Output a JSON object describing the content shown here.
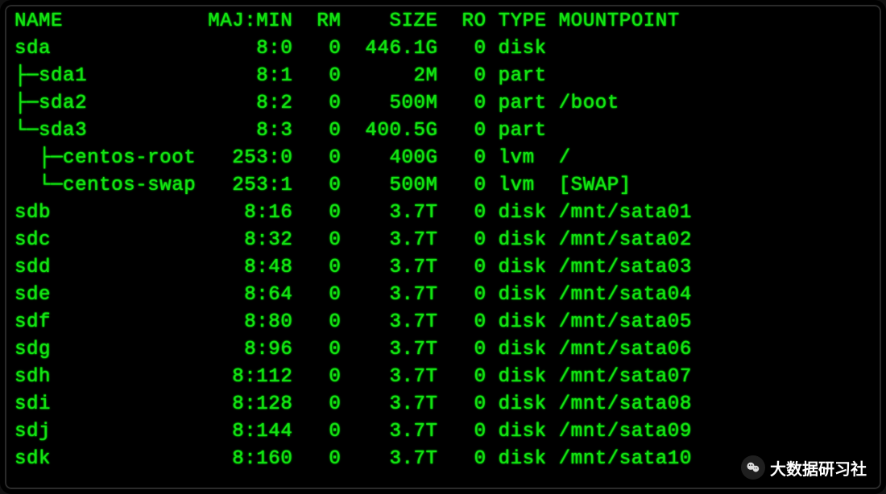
{
  "terminal": {
    "headers": {
      "name": "NAME",
      "majmin": "MAJ:MIN",
      "rm": "RM",
      "size": "SIZE",
      "ro": "RO",
      "type": "TYPE",
      "mountpoint": "MOUNTPOINT"
    },
    "rows": [
      {
        "tree": "",
        "name": "sda",
        "majmin": "8:0",
        "rm": "0",
        "size": "446.1G",
        "ro": "0",
        "type": "disk",
        "mountpoint": ""
      },
      {
        "tree": "├─",
        "name": "sda1",
        "majmin": "8:1",
        "rm": "0",
        "size": "2M",
        "ro": "0",
        "type": "part",
        "mountpoint": ""
      },
      {
        "tree": "├─",
        "name": "sda2",
        "majmin": "8:2",
        "rm": "0",
        "size": "500M",
        "ro": "0",
        "type": "part",
        "mountpoint": "/boot"
      },
      {
        "tree": "└─",
        "name": "sda3",
        "majmin": "8:3",
        "rm": "0",
        "size": "400.5G",
        "ro": "0",
        "type": "part",
        "mountpoint": ""
      },
      {
        "tree": "  ├─",
        "name": "centos-root",
        "majmin": "253:0",
        "rm": "0",
        "size": "400G",
        "ro": "0",
        "type": "lvm",
        "mountpoint": "/"
      },
      {
        "tree": "  └─",
        "name": "centos-swap",
        "majmin": "253:1",
        "rm": "0",
        "size": "500M",
        "ro": "0",
        "type": "lvm",
        "mountpoint": "[SWAP]"
      },
      {
        "tree": "",
        "name": "sdb",
        "majmin": "8:16",
        "rm": "0",
        "size": "3.7T",
        "ro": "0",
        "type": "disk",
        "mountpoint": "/mnt/sata01"
      },
      {
        "tree": "",
        "name": "sdc",
        "majmin": "8:32",
        "rm": "0",
        "size": "3.7T",
        "ro": "0",
        "type": "disk",
        "mountpoint": "/mnt/sata02"
      },
      {
        "tree": "",
        "name": "sdd",
        "majmin": "8:48",
        "rm": "0",
        "size": "3.7T",
        "ro": "0",
        "type": "disk",
        "mountpoint": "/mnt/sata03"
      },
      {
        "tree": "",
        "name": "sde",
        "majmin": "8:64",
        "rm": "0",
        "size": "3.7T",
        "ro": "0",
        "type": "disk",
        "mountpoint": "/mnt/sata04"
      },
      {
        "tree": "",
        "name": "sdf",
        "majmin": "8:80",
        "rm": "0",
        "size": "3.7T",
        "ro": "0",
        "type": "disk",
        "mountpoint": "/mnt/sata05"
      },
      {
        "tree": "",
        "name": "sdg",
        "majmin": "8:96",
        "rm": "0",
        "size": "3.7T",
        "ro": "0",
        "type": "disk",
        "mountpoint": "/mnt/sata06"
      },
      {
        "tree": "",
        "name": "sdh",
        "majmin": "8:112",
        "rm": "0",
        "size": "3.7T",
        "ro": "0",
        "type": "disk",
        "mountpoint": "/mnt/sata07"
      },
      {
        "tree": "",
        "name": "sdi",
        "majmin": "8:128",
        "rm": "0",
        "size": "3.7T",
        "ro": "0",
        "type": "disk",
        "mountpoint": "/mnt/sata08"
      },
      {
        "tree": "",
        "name": "sdj",
        "majmin": "8:144",
        "rm": "0",
        "size": "3.7T",
        "ro": "0",
        "type": "disk",
        "mountpoint": "/mnt/sata09"
      },
      {
        "tree": "",
        "name": "sdk",
        "majmin": "8:160",
        "rm": "0",
        "size": "3.7T",
        "ro": "0",
        "type": "disk",
        "mountpoint": "/mnt/sata10"
      }
    ]
  },
  "watermark": {
    "text": "大数据研习社"
  },
  "layout": {
    "col_name_width": 15,
    "col_majmin_width": 7,
    "col_rm_width": 3,
    "col_size_width": 7,
    "col_ro_width": 3,
    "col_type_width": 4
  }
}
